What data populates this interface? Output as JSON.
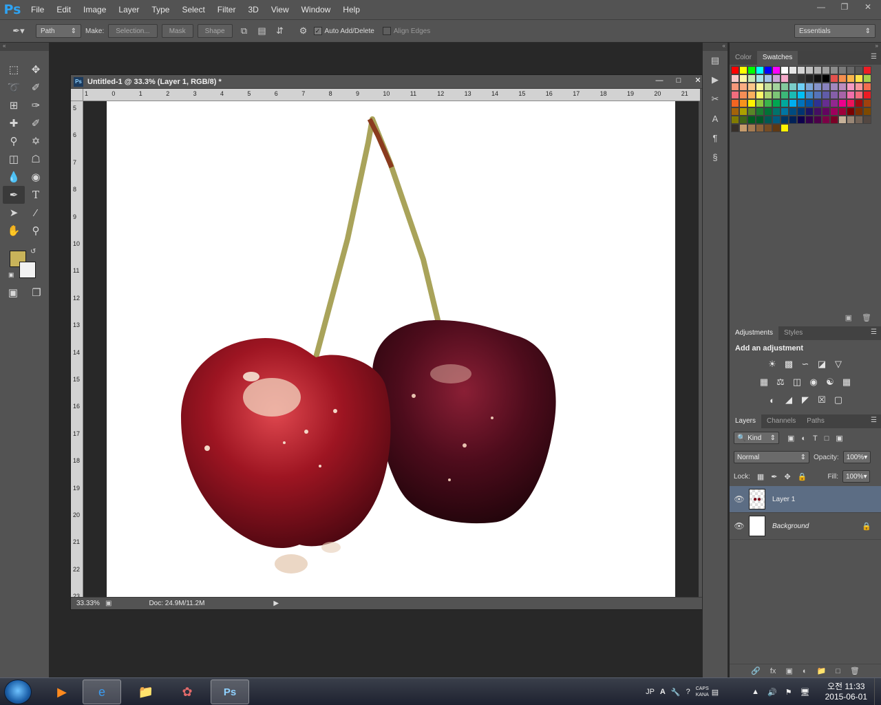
{
  "app": {
    "logo": "Ps",
    "menu": [
      "File",
      "Edit",
      "Image",
      "Layer",
      "Type",
      "Select",
      "Filter",
      "3D",
      "View",
      "Window",
      "Help"
    ]
  },
  "options_bar": {
    "mode_select": "Path",
    "make_label": "Make:",
    "selection_btn": "Selection...",
    "mask_btn": "Mask",
    "shape_btn": "Shape",
    "auto_add_delete": "Auto Add/Delete",
    "auto_add_delete_checked": true,
    "align_edges": "Align Edges",
    "align_edges_checked": false,
    "workspace": "Essentials"
  },
  "toolbar": {
    "foreground_color": "#c8b35a",
    "background_color": "#f2f2f2",
    "active_tool": "pen-tool"
  },
  "document": {
    "title": "Untitled-1 @ 33.3% (Layer 1, RGB/8) *",
    "zoom": "33.33%",
    "doc_info": "Doc: 24.9M/11.2M",
    "ruler_h": [
      "1",
      "0",
      "1",
      "2",
      "3",
      "4",
      "5",
      "6",
      "7",
      "8",
      "9",
      "10",
      "11",
      "12",
      "13",
      "14",
      "15",
      "16",
      "17",
      "18",
      "19",
      "20",
      "21"
    ],
    "ruler_v": [
      "5",
      "6",
      "7",
      "8",
      "9",
      "10",
      "11",
      "12",
      "13",
      "14",
      "15",
      "16",
      "17",
      "18",
      "19",
      "20",
      "21",
      "22",
      "23"
    ]
  },
  "color_panel": {
    "tabs": [
      "Color",
      "Swatches"
    ],
    "active_tab": "Swatches",
    "swatches": [
      "#ff0000",
      "#ffff00",
      "#00ff00",
      "#00ffff",
      "#0000ff",
      "#ff00ff",
      "#ffffff",
      "#e6e6e6",
      "#d4d4d4",
      "#c2c2c2",
      "#b0b0b0",
      "#9e9e9e",
      "#8c8c8c",
      "#7a7a7a",
      "#686868",
      "#565656",
      "#ee1d24",
      "#f8c9c9",
      "#fdf6a7",
      "#c6e6b3",
      "#a6dfe8",
      "#a3c1e8",
      "#c9a7d6",
      "#f4a8c8",
      "#444444",
      "#333333",
      "#222222",
      "#111111",
      "#000000",
      "#e4504d",
      "#f58e4e",
      "#f9b54a",
      "#fde34a",
      "#a6cf4b",
      "#f7977a",
      "#fbad82",
      "#fdc689",
      "#fff79a",
      "#c4df9b",
      "#a3d39c",
      "#82ca9c",
      "#7accc8",
      "#6dcff6",
      "#7ea7d8",
      "#8493ca",
      "#8882be",
      "#a187be",
      "#bc8dbf",
      "#f49ac2",
      "#f6989d",
      "#f26c4f",
      "#f26d7d",
      "#f68e56",
      "#fbaf5d",
      "#fff568",
      "#acd373",
      "#7cc576",
      "#3bb878",
      "#1abbb4",
      "#00bff3",
      "#438ccb",
      "#5574b9",
      "#605ca8",
      "#855fa8",
      "#a763a8",
      "#f06eaa",
      "#f26d7d",
      "#ed1c24",
      "#f26522",
      "#f7941d",
      "#fff200",
      "#8dc63f",
      "#39b54a",
      "#00a651",
      "#00a99d",
      "#00aeef",
      "#0072bc",
      "#0054a6",
      "#2e3192",
      "#662d91",
      "#92278f",
      "#ec008c",
      "#ed145b",
      "#9e0b0f",
      "#a0410d",
      "#a3620a",
      "#aba000",
      "#598527",
      "#1a7b30",
      "#007236",
      "#00746b",
      "#0076a3",
      "#004b80",
      "#003471",
      "#1b1464",
      "#440e62",
      "#630460",
      "#9e005d",
      "#9e0039",
      "#790000",
      "#7b2e00",
      "#7d4900",
      "#827b00",
      "#406618",
      "#005e20",
      "#005826",
      "#005952",
      "#005b7f",
      "#003663",
      "#002157",
      "#0d004c",
      "#32004b",
      "#4b0049",
      "#7b0046",
      "#7a0026",
      "#c7b299",
      "#998675",
      "#736357",
      "#534741",
      "#37302a",
      "#c69c6d",
      "#a67c52",
      "#8c6239",
      "#754c24",
      "#603913",
      "#fff200"
    ]
  },
  "adjustments_panel": {
    "tabs": [
      "Adjustments",
      "Styles"
    ],
    "active_tab": "Adjustments",
    "title": "Add an adjustment",
    "rows": [
      [
        "brightness-icon",
        "levels-icon",
        "curves-icon",
        "exposure-icon",
        "vibrance-icon"
      ],
      [
        "hue-sat-icon",
        "color-balance-icon",
        "black-white-icon",
        "photo-filter-icon",
        "channel-mixer-icon",
        "color-lookup-icon"
      ],
      [
        "invert-icon",
        "posterize-icon",
        "threshold-icon",
        "selective-color-icon",
        "gradient-map-icon"
      ]
    ]
  },
  "layers_panel": {
    "tabs": [
      "Layers",
      "Channels",
      "Paths"
    ],
    "active_tab": "Layers",
    "kind_filter": "Kind",
    "blend_mode": "Normal",
    "opacity_label": "Opacity:",
    "opacity": "100%",
    "lock_label": "Lock:",
    "fill_label": "Fill:",
    "fill": "100%",
    "layers": [
      {
        "name": "Layer 1",
        "selected": true,
        "italic": false
      },
      {
        "name": "Background",
        "selected": false,
        "italic": true
      }
    ]
  },
  "taskbar": {
    "language": "JP",
    "caps": "CAPS",
    "kana": "KANA",
    "time": "오전 11:33",
    "date": "2015-06-01"
  }
}
